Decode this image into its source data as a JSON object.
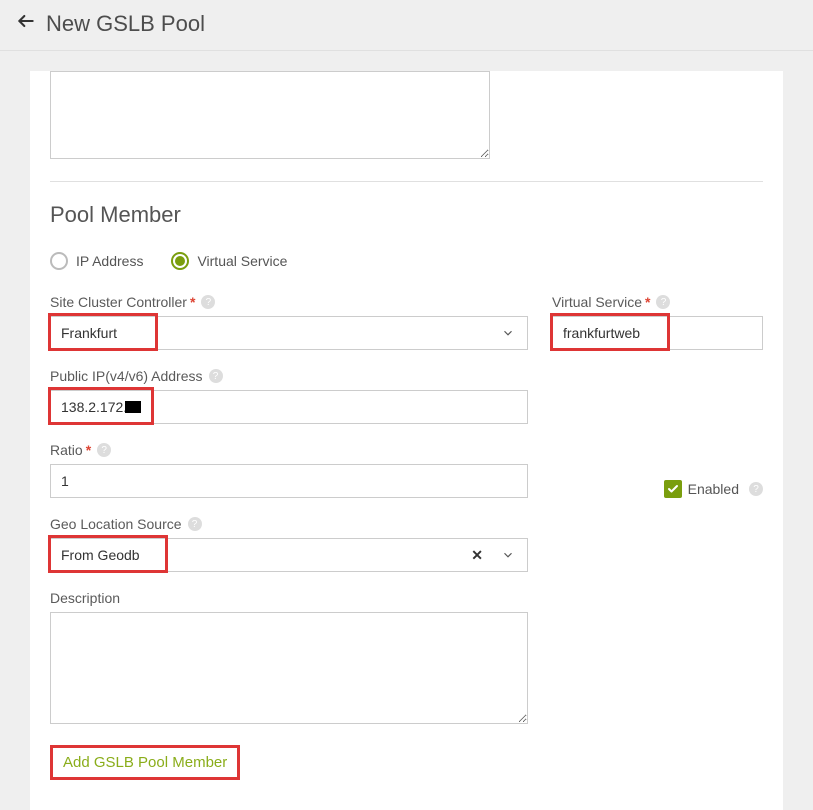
{
  "header": {
    "title": "New GSLB Pool"
  },
  "section": {
    "title": "Pool Member"
  },
  "radios": {
    "ip_label": "IP Address",
    "vs_label": "Virtual Service",
    "selected": "virtual_service"
  },
  "fields": {
    "site_cluster": {
      "label": "Site Cluster Controller",
      "value": "Frankfurt"
    },
    "virtual_service": {
      "label": "Virtual Service",
      "value": "frankfurtweb"
    },
    "public_ip": {
      "label": "Public IP(v4/v6) Address",
      "value": "138.2.172."
    },
    "ratio": {
      "label": "Ratio",
      "value": "1"
    },
    "enabled": {
      "label": "Enabled",
      "checked": true
    },
    "geo": {
      "label": "Geo Location Source",
      "value": "From Geodb"
    },
    "description": {
      "label": "Description",
      "value": ""
    }
  },
  "actions": {
    "add_member": "Add GSLB Pool Member"
  }
}
